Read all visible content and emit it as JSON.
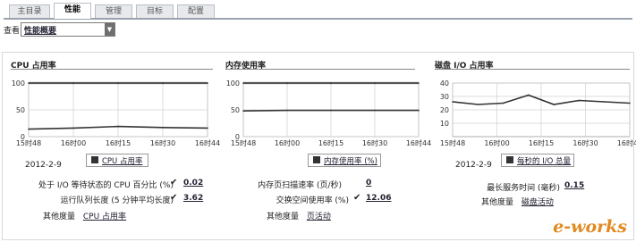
{
  "tabs": [
    {
      "label": "主目录",
      "active": false
    },
    {
      "label": "性能",
      "active": true
    },
    {
      "label": "管理",
      "active": false
    },
    {
      "label": "目标",
      "active": false
    },
    {
      "label": "配置",
      "active": false
    }
  ],
  "view": {
    "label": "查看",
    "selected": "性能概要"
  },
  "panels": {
    "cpu": {
      "title": "CPU 占用率",
      "legend": "CPU 占用率",
      "date": "2012-2-9",
      "stats": [
        {
          "label": "处于 I/O 等待状态的 CPU 百分比 (%)",
          "value": "0.02"
        },
        {
          "label": "运行队列长度 (5 分钟平均长度)",
          "value": "3.62"
        }
      ],
      "other_label": "其他度量",
      "other_link": "CPU 占用率"
    },
    "memory": {
      "title": "内存使用率",
      "legend": "内存使用率 (%)",
      "stats": [
        {
          "label": "内存页扫描速率 (页/秒)",
          "value": "0"
        },
        {
          "label": "交换空间使用率 (%)",
          "value": "12.06"
        }
      ],
      "other_label": "其他度量",
      "other_link": "页活动"
    },
    "disk": {
      "title": "磁盘 I/O 占用率",
      "legend": "每秒的 I/O 总量",
      "date": "2012-2-9",
      "stats": [
        {
          "label": "最长服务时间 (毫秒)",
          "value": "0.15"
        }
      ],
      "other_label": "其他度量",
      "other_link": "磁盘活动"
    }
  },
  "logo": {
    "text": "e-works"
  },
  "colors": {
    "tab_border": "#9aa3ad",
    "line": "#444444",
    "logo_orange": "#e2891f"
  },
  "chart_data": [
    {
      "type": "line",
      "x": [
        "15时48",
        "16时00",
        "16时15",
        "16时30",
        "16时44"
      ],
      "ylim": [
        0,
        100
      ],
      "yticks": [
        0,
        50,
        100
      ],
      "series": [
        {
          "name": "",
          "values": [
            100,
            100,
            100,
            100,
            100
          ]
        },
        {
          "name": "CPU 占用率",
          "values": [
            14,
            16,
            19,
            17,
            16
          ]
        }
      ]
    },
    {
      "type": "line",
      "x": [
        "15时48",
        "16时00",
        "16时15",
        "16时30",
        "16时44"
      ],
      "ylim": [
        0,
        100
      ],
      "yticks": [
        0,
        50,
        100
      ],
      "series": [
        {
          "name": "",
          "values": [
            100,
            100,
            100,
            100,
            100
          ]
        },
        {
          "name": "内存使用率 (%)",
          "values": [
            48,
            49,
            49,
            49,
            49
          ]
        }
      ]
    },
    {
      "type": "line",
      "x": [
        "15时48",
        "16时00",
        "16时15",
        "16时30",
        "16时44"
      ],
      "ylim": [
        0,
        40
      ],
      "yticks": [
        10,
        20,
        30,
        40
      ],
      "series": [
        {
          "name": "每秒的 I/O 总量",
          "values": [
            26,
            24,
            25,
            31,
            24,
            27,
            26,
            25
          ]
        }
      ]
    }
  ]
}
